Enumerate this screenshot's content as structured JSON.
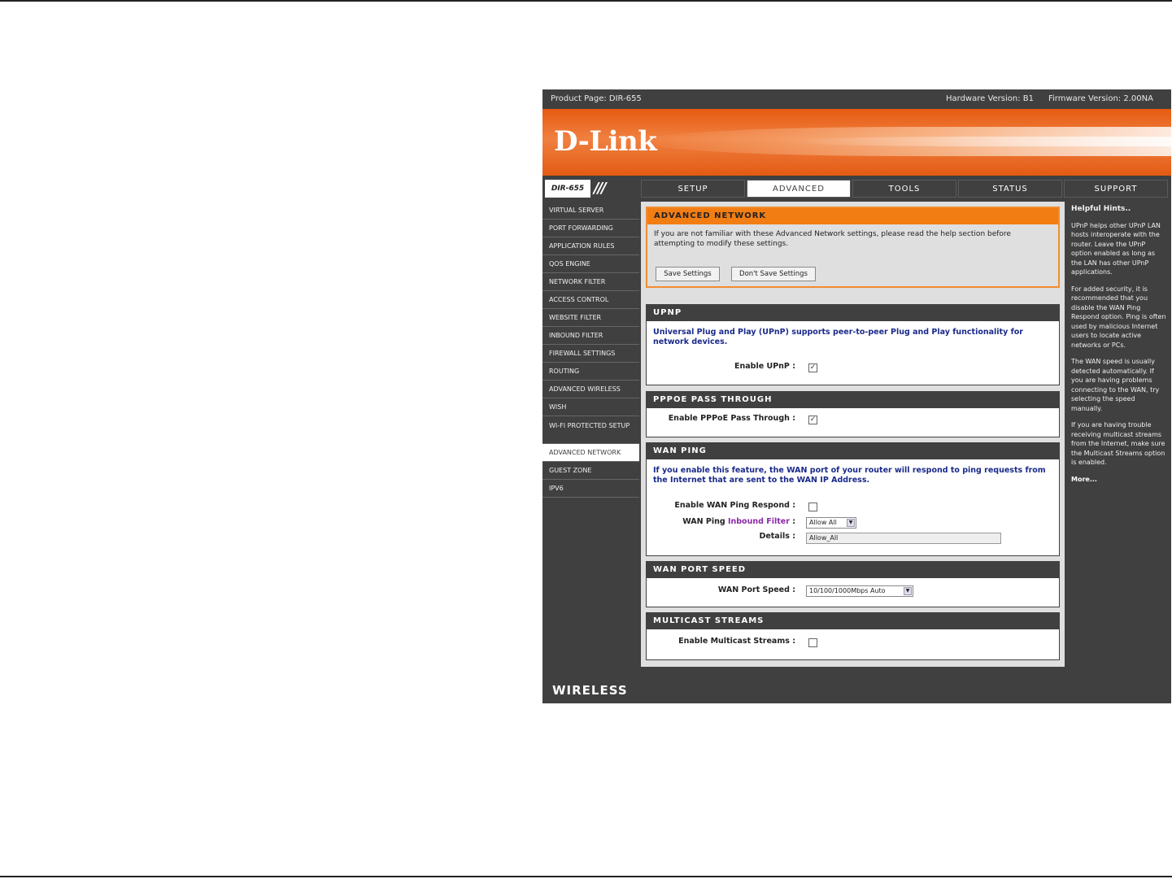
{
  "topbar": {
    "product_page": "Product Page: DIR-655",
    "hardware_version": "Hardware Version: B1",
    "firmware_version": "Firmware Version: 2.00NA"
  },
  "brand": {
    "logo": "D-Link",
    "footer": "WIRELESS"
  },
  "model": "DIR-655",
  "tabs": [
    {
      "label": "SETUP",
      "active": false
    },
    {
      "label": "ADVANCED",
      "active": true
    },
    {
      "label": "TOOLS",
      "active": false
    },
    {
      "label": "STATUS",
      "active": false
    },
    {
      "label": "SUPPORT",
      "active": false
    }
  ],
  "sidebar": [
    "VIRTUAL SERVER",
    "PORT FORWARDING",
    "APPLICATION RULES",
    "QOS ENGINE",
    "NETWORK FILTER",
    "ACCESS CONTROL",
    "WEBSITE FILTER",
    "INBOUND FILTER",
    "FIREWALL SETTINGS",
    "ROUTING",
    "ADVANCED WIRELESS",
    "WISH",
    "WI-FI PROTECTED SETUP",
    "ADVANCED NETWORK",
    "GUEST ZONE",
    "IPV6"
  ],
  "sidebar_active": "ADVANCED NETWORK",
  "intro": {
    "title": "ADVANCED NETWORK",
    "text": "If you are not familiar with these Advanced Network settings, please read the help section before attempting to modify these settings.",
    "save_label": "Save Settings",
    "dont_save_label": "Don't Save Settings"
  },
  "upnp": {
    "title": "UPNP",
    "description": "Universal Plug and Play (UPnP) supports peer-to-peer Plug and Play functionality for network devices.",
    "enable_label": "Enable UPnP :",
    "enabled": true
  },
  "pppoe": {
    "title": "PPPOE PASS THROUGH",
    "enable_label": "Enable PPPoE Pass Through :",
    "enabled": true
  },
  "wan_ping": {
    "title": "WAN PING",
    "description": "If you enable this feature, the WAN port of your router will respond to ping requests from the Internet that are sent to the WAN IP Address.",
    "respond_label": "Enable WAN Ping Respond :",
    "respond_enabled": false,
    "filter_label_prefix": "WAN Ping ",
    "filter_label_link": "Inbound Filter",
    "filter_label_suffix": " :",
    "filter_value": "Allow All",
    "details_label": "Details :",
    "details_value": "Allow_All"
  },
  "wan_port_speed": {
    "title": "WAN PORT SPEED",
    "label": "WAN Port Speed :",
    "value": "10/100/1000Mbps Auto"
  },
  "multicast": {
    "title": "MULTICAST STREAMS",
    "label": "Enable Multicast Streams :",
    "enabled": false
  },
  "hints": {
    "title": "Helpful Hints..",
    "paragraphs": [
      "UPnP helps other UPnP LAN hosts interoperate with the router. Leave the UPnP option enabled as long as the LAN has other UPnP applications.",
      "For added security, it is recommended that you disable the WAN Ping Respond option. Ping is often used by malicious Internet users to locate active networks or PCs.",
      "The WAN speed is usually detected automatically. If you are having problems connecting to the WAN, try selecting the speed manually.",
      "If you are having trouble receiving multicast streams from the Internet, make sure the Multicast Streams option is enabled."
    ],
    "more": "More..."
  }
}
